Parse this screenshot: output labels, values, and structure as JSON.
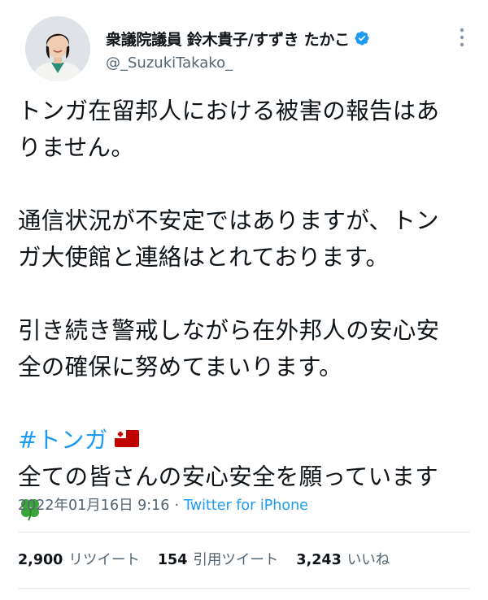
{
  "author": {
    "display_name": "衆議院議員 鈴木貴子/すずき たかこ",
    "handle": "@_SuzukiTakako_",
    "verified": true,
    "avatar_icon": "profile-photo"
  },
  "more_icon": "more-vertical-icon",
  "tweet": {
    "paragraph1_line1": "トンガ在留邦人における被害の報告はあ",
    "paragraph1_line2": "りません。",
    "paragraph2_line1": "通信状況が不安定ではありますが、トン",
    "paragraph2_line2": "ガ大使館と連絡はとれております。",
    "paragraph3_line1": "引き続き警戒しながら在外邦人の安心安",
    "paragraph3_line2": "全の確保に努めてまいります。",
    "hashtag": "#トンガ",
    "hashtag_emoji": "tonga-flag-emoji",
    "closing_line": "全ての皆さんの安心安全を願っています",
    "closing_emoji": "four-leaf-clover-emoji"
  },
  "meta": {
    "timestamp": "2022年01月16日 9:16",
    "separator": "·",
    "source": "Twitter for iPhone"
  },
  "stats": {
    "retweets_count": "2,900",
    "retweets_label": "リツイート",
    "quotes_count": "154",
    "quotes_label": "引用ツイート",
    "likes_count": "3,243",
    "likes_label": "いいね"
  },
  "colors": {
    "link": "#1d9bf0",
    "secondary_text": "#536471",
    "primary_text": "#0f1419",
    "verified_badge": "#1d9bf0"
  }
}
